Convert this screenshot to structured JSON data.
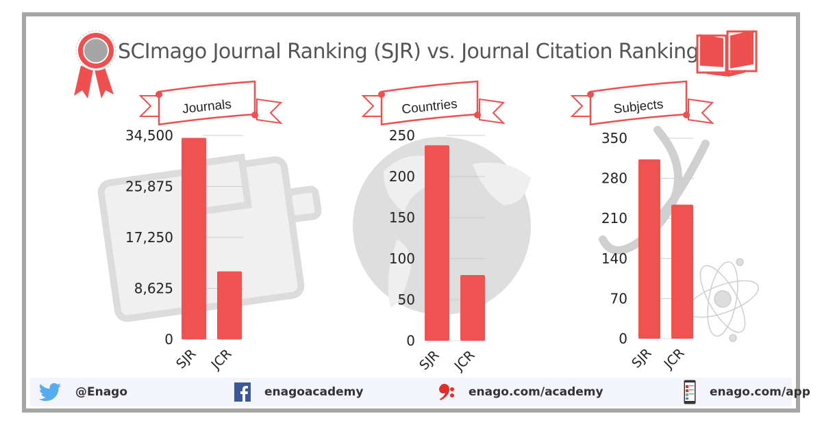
{
  "title": "SCImago Journal Ranking (SJR) vs. Journal Citation Ranking (JCR)",
  "colors": {
    "bar": "#f05252",
    "accent": "#ee4f4f",
    "frame": "#a6a6a6",
    "grid": "#cccccc",
    "text": "#222222"
  },
  "chart_data": [
    {
      "type": "bar",
      "title": "Journals",
      "categories": [
        "SJR",
        "JCR"
      ],
      "values": [
        34100,
        11500
      ],
      "yticks": [
        0,
        8625,
        17250,
        25875,
        34500
      ],
      "ytick_labels": [
        "0",
        "8,625",
        "17,250",
        "25,875",
        "34,500"
      ],
      "ylim": [
        0,
        34500
      ],
      "grid": true,
      "background_icon": "notebook-icon"
    },
    {
      "type": "bar",
      "title": "Countries",
      "categories": [
        "SJR",
        "JCR"
      ],
      "values": [
        238,
        80
      ],
      "yticks": [
        0,
        50,
        100,
        150,
        200,
        250
      ],
      "ytick_labels": [
        "0",
        "50",
        "100",
        "150",
        "200",
        "250"
      ],
      "ylim": [
        0,
        250
      ],
      "grid": true,
      "background_icon": "globe-icon"
    },
    {
      "type": "bar",
      "title": "Subjects",
      "categories": [
        "SJR",
        "JCR"
      ],
      "values": [
        313,
        234
      ],
      "yticks": [
        0,
        70,
        140,
        210,
        280,
        350
      ],
      "ytick_labels": [
        "0",
        "70",
        "140",
        "210",
        "280",
        "350"
      ],
      "ylim": [
        0,
        350
      ],
      "grid": true,
      "background_icon": "dna-atom-icon"
    }
  ],
  "footer": {
    "twitter": "@Enago",
    "facebook": "enagoacademy",
    "web": "enago.com/academy",
    "app": "enago.com/app"
  }
}
